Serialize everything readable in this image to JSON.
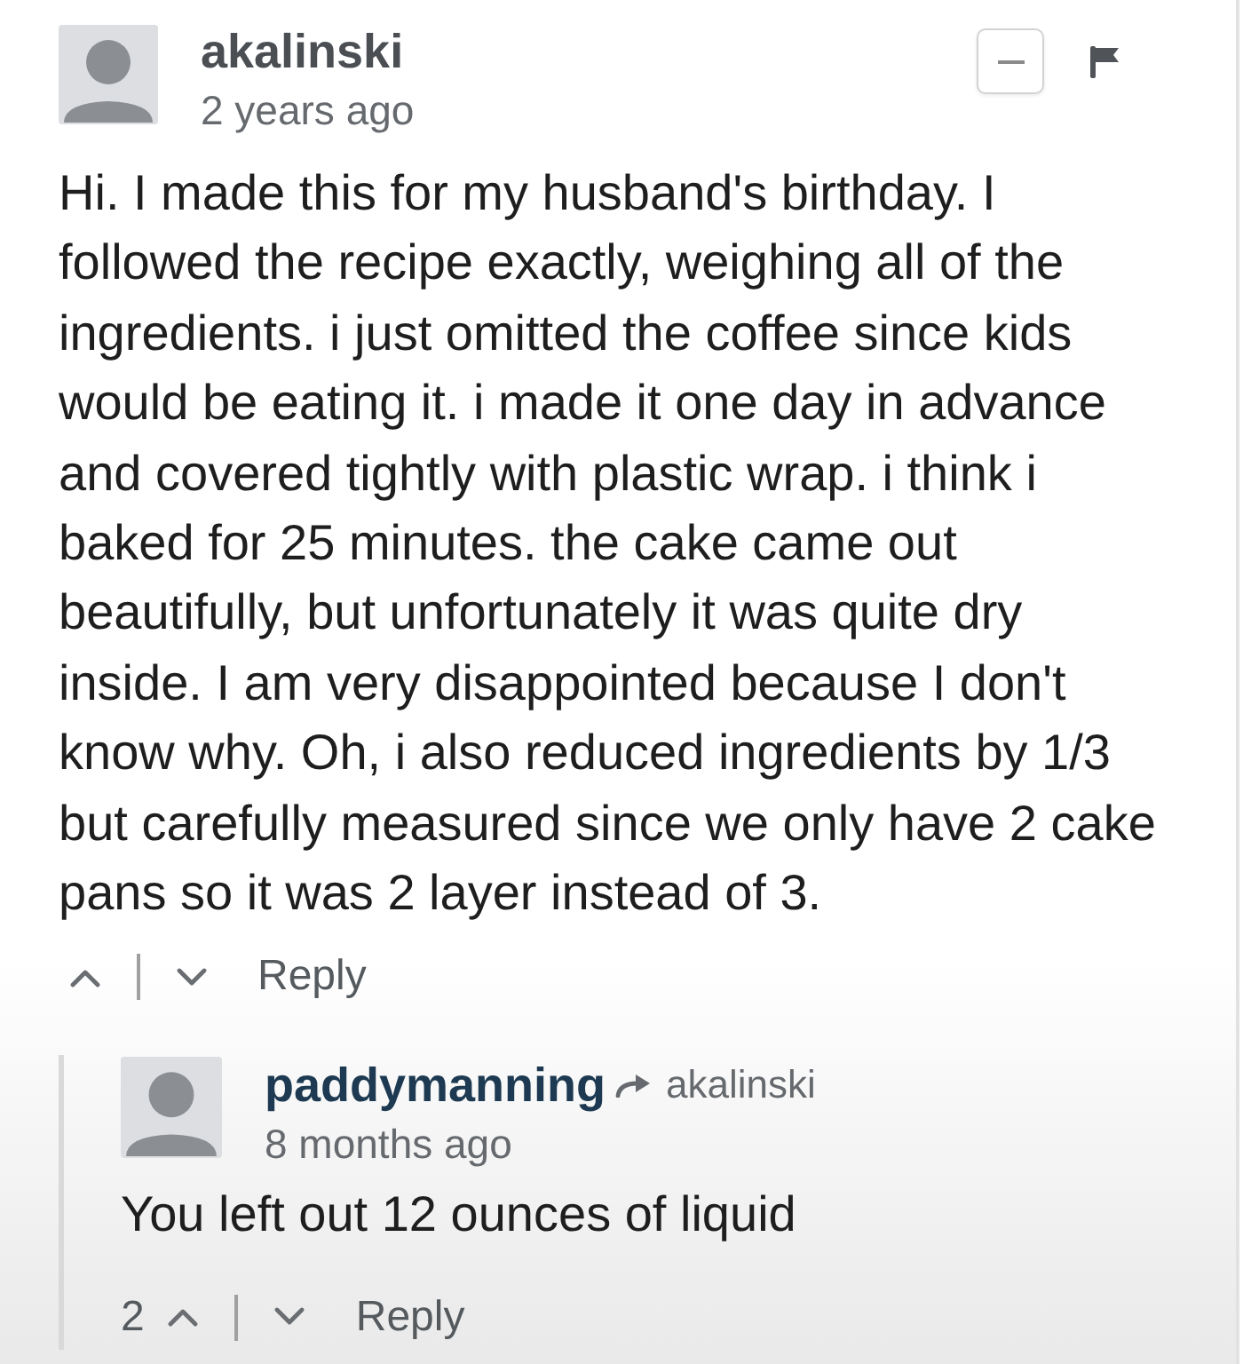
{
  "comment": {
    "author": "akalinski",
    "time": "2 years ago",
    "show_controls": true,
    "body": "Hi. I made this for my husband's birthday. I\nfollowed the recipe exactly, weighing all of the\ningredients. i just omitted the coffee since kids\nwould be eating it. i made it one day in advance\nand covered tightly with plastic wrap. i think i\nbaked for 25 minutes. the cake came out\nbeautifully, but unfortunately it was quite dry\ninside. I am very disappointed because I don't\nknow why. Oh, i also reduced ingredients by 1/3\nbut carefully measured since we only have 2 cake\npans so it was 2 layer instead of 3.",
    "reply_label": "Reply",
    "replies": [
      {
        "author": "paddymanning",
        "reply_to": "akalinski",
        "time": "8 months ago",
        "show_controls": false,
        "body": "You left out 12 ounces of liquid",
        "upvotes": "2",
        "reply_label": "Reply"
      }
    ]
  }
}
